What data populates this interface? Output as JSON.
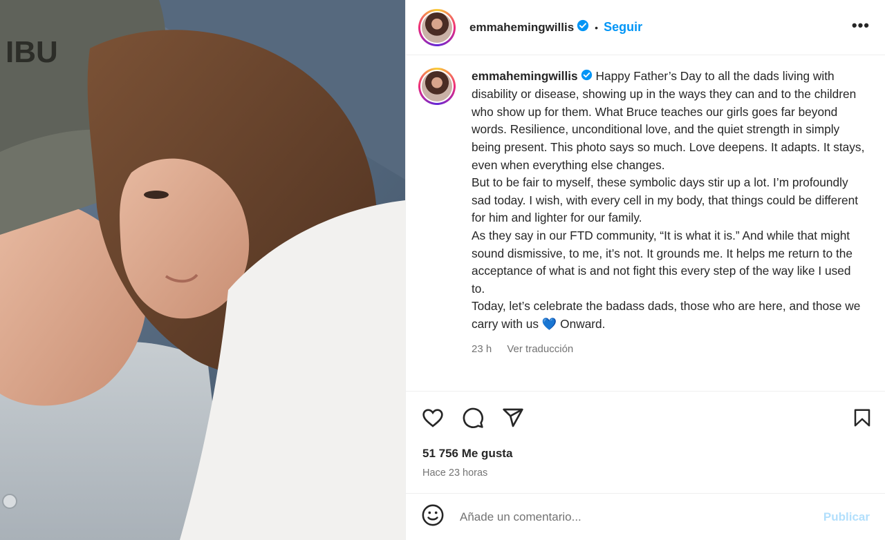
{
  "post": {
    "username": "emmahemingwillis",
    "follow_label": "Seguir",
    "separator": "•",
    "more_label": "•••",
    "caption": {
      "username": "emmahemingwillis",
      "paragraphs": [
        "Happy Father’s Day to all the dads living with disability or disease, showing up in the ways they can and to the children who show up for them. What Bruce teaches our girls goes far beyond words. Resilience, unconditional love, and the quiet strength in simply being present. This photo says so much. Love deepens. It adapts. It stays, even when everything else changes.",
        "But to be fair to myself, these symbolic days stir up a lot. I’m profoundly sad today. I wish, with every cell in my body, that things could be different for him and lighter for our family.",
        "As they say in our FTD community, “It is what it is.” And while that might sound dismissive, to me, it’s not. It grounds me. It helps me return to the acceptance of what is and not fight this every step of the way like I used to.",
        "Today, let’s celebrate the badass dads, those who are here, and those we carry with us",
        "Onward."
      ],
      "heart_emoji": "💙"
    },
    "time_ago": "23 h",
    "translate_label": "Ver traducción",
    "likes": "51 756 Me gusta",
    "posted": "Hace 23 horas",
    "comment_placeholder": "Añade un comentario...",
    "publish_label": "Publicar",
    "colors": {
      "accent": "#0095f6",
      "publish_disabled": "#b2dffc",
      "heart_blue": "#1877f2",
      "muted": "#737373"
    },
    "icons": [
      "heart-icon",
      "comment-icon",
      "share-icon",
      "bookmark-icon",
      "emoji-icon",
      "verified-icon",
      "more-icon"
    ]
  }
}
